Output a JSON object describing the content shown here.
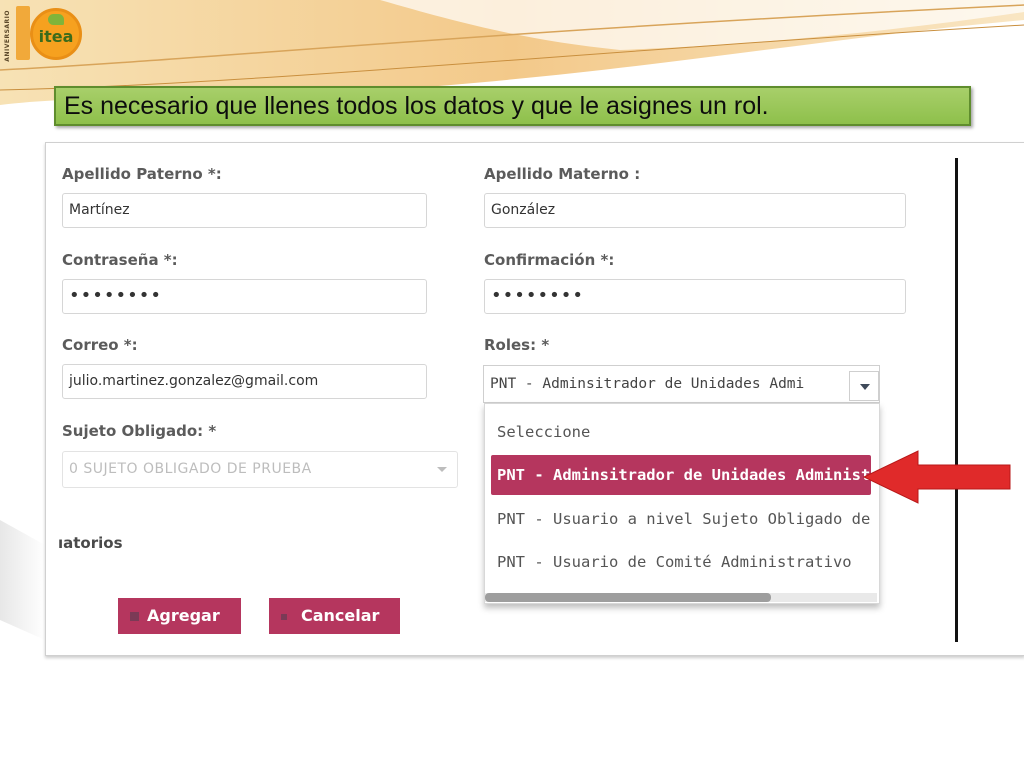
{
  "logo": {
    "brand_text": "itea",
    "side_text": "ANIVERSARIO"
  },
  "slide": {
    "title": "Es necesario que llenes todos los datos y que le asignes un rol."
  },
  "form": {
    "apellido_paterno": {
      "label": "Apellido Paterno *:",
      "value": "Martínez"
    },
    "apellido_materno": {
      "label": "Apellido Materno :",
      "value": "González"
    },
    "contrasena": {
      "label": "Contraseña *:",
      "value": "••••••••"
    },
    "confirmacion": {
      "label": "Confirmación *:",
      "value": "••••••••"
    },
    "correo": {
      "label": "Correo *:",
      "value": "julio.martinez.gonzalez@gmail.com"
    },
    "roles": {
      "label": "Roles: *",
      "selected": "PNT - Adminsitrador de Unidades Admi",
      "options": [
        "Seleccione",
        "PNT - Adminsitrador de Unidades Administr",
        "PNT - Usuario a nivel Sujeto Obligado de la E",
        "PNT - Usuario de Comité Administrativo"
      ],
      "highlighted_index": 1
    },
    "sujeto_obligado": {
      "label": "Sujeto Obligado: *",
      "value": "0 SUJETO OBLIGADO DE PRUEBA"
    },
    "section_fragment": "ıatorios"
  },
  "buttons": {
    "agregar": "Agregar",
    "cancelar": "Cancelar"
  },
  "colors": {
    "accent": "#b5365e",
    "title_bg": "#9cc85a",
    "arrow": "#e02a2a"
  }
}
